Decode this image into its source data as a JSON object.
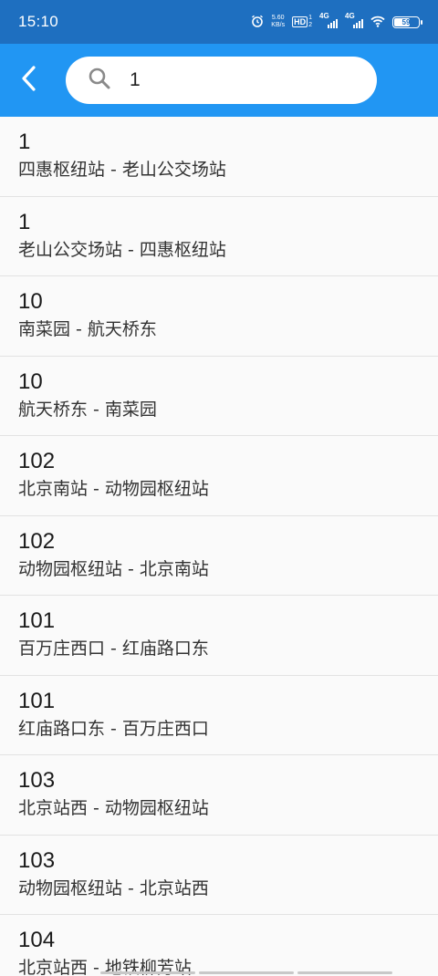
{
  "status_bar": {
    "time": "15:10",
    "net_speed_value": "5.60",
    "net_speed_unit": "KB/s",
    "hd_label": "HD",
    "hd_sub1": "1",
    "hd_sub2": "2",
    "signal1_label": "4G",
    "signal2_label": "4G",
    "battery_level": "59"
  },
  "header": {
    "search_value": "1",
    "back_icon": "chevron-left-icon",
    "search_icon": "search-icon"
  },
  "routes": [
    {
      "number": "1",
      "desc": "四惠枢纽站 - 老山公交场站"
    },
    {
      "number": "1",
      "desc": "老山公交场站 - 四惠枢纽站"
    },
    {
      "number": "10",
      "desc": "南菜园 - 航天桥东"
    },
    {
      "number": "10",
      "desc": "航天桥东 - 南菜园"
    },
    {
      "number": "102",
      "desc": "北京南站 - 动物园枢纽站"
    },
    {
      "number": "102",
      "desc": "动物园枢纽站 - 北京南站"
    },
    {
      "number": "101",
      "desc": "百万庄西口 - 红庙路口东"
    },
    {
      "number": "101",
      "desc": "红庙路口东 - 百万庄西口"
    },
    {
      "number": "103",
      "desc": "北京站西 - 动物园枢纽站"
    },
    {
      "number": "103",
      "desc": "动物园枢纽站 - 北京站西"
    },
    {
      "number": "104",
      "desc": "北京站西 - 地铁柳芳站"
    }
  ],
  "colors": {
    "status_bar": "#1e6fc0",
    "app_bar": "#2196f3",
    "background": "#fafafa"
  }
}
